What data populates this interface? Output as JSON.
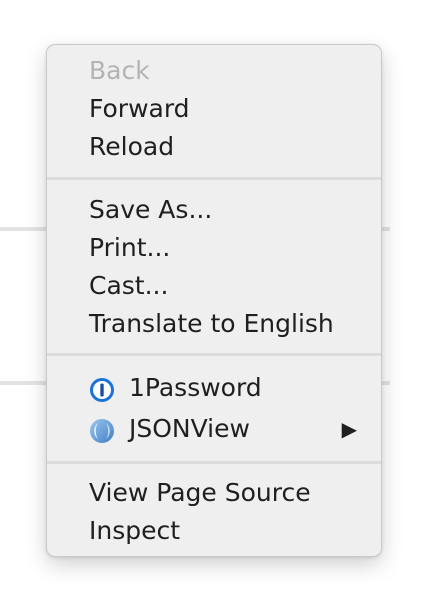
{
  "context_menu": {
    "group1": {
      "back": "Back",
      "forward": "Forward",
      "reload": "Reload"
    },
    "group2": {
      "save_as": "Save As...",
      "print": "Print...",
      "cast": "Cast...",
      "translate": "Translate to English"
    },
    "group3": {
      "onepassword": "1Password",
      "jsonview": "JSONView",
      "submenu_arrow": "▶"
    },
    "group4": {
      "view_source": "View Page Source",
      "inspect": "Inspect"
    },
    "icons": {
      "onepassword": "1password-icon",
      "jsonview": "jsonview-icon"
    }
  }
}
